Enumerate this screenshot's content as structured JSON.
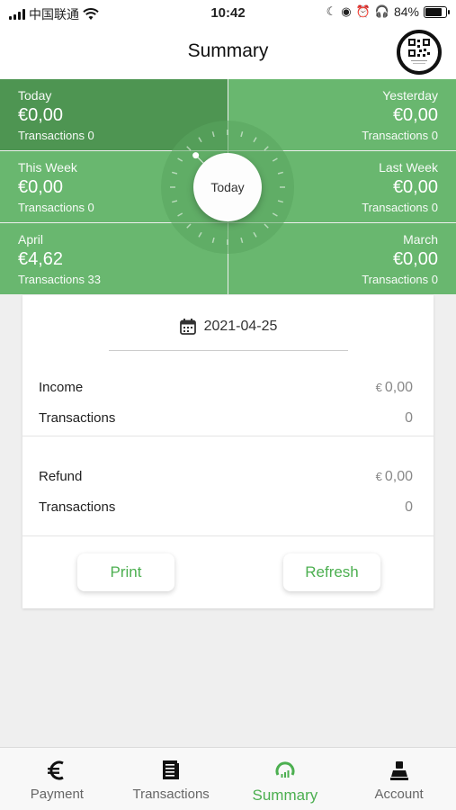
{
  "status_bar": {
    "carrier": "中国联通",
    "time": "10:42",
    "battery": "84%",
    "battery_level": 0.84
  },
  "header": {
    "title": "Summary",
    "avatar_icon": "qr-code-icon"
  },
  "tiles": [
    {
      "label": "Today",
      "amount": "€0,00",
      "transactions": "Transactions 0"
    },
    {
      "label": "Yesterday",
      "amount": "€0,00",
      "transactions": "Transactions 0"
    },
    {
      "label": "This Week",
      "amount": "€0,00",
      "transactions": "Transactions 0"
    },
    {
      "label": "Last Week",
      "amount": "€0,00",
      "transactions": "Transactions 0"
    },
    {
      "label": "April",
      "amount": "€4,62",
      "transactions": "Transactions 33"
    },
    {
      "label": "March",
      "amount": "€0,00",
      "transactions": "Transactions 0"
    }
  ],
  "dial": {
    "label": "Today"
  },
  "card": {
    "date": "2021-04-25",
    "income": {
      "label": "Income",
      "currency": "€",
      "value": "0,00"
    },
    "income_tx": {
      "label": "Transactions",
      "value": "0"
    },
    "refund": {
      "label": "Refund",
      "currency": "€",
      "value": "0,00"
    },
    "refund_tx": {
      "label": "Transactions",
      "value": "0"
    },
    "print_label": "Print",
    "refresh_label": "Refresh"
  },
  "tabbar": {
    "items": [
      {
        "label": "Payment",
        "icon": "euro-icon"
      },
      {
        "label": "Transactions",
        "icon": "receipt-icon"
      },
      {
        "label": "Summary",
        "icon": "summary-icon"
      },
      {
        "label": "Account",
        "icon": "account-icon"
      }
    ]
  },
  "colors": {
    "tile": "#69b76f",
    "tile_active": "#4e9552",
    "accent": "#4caf50"
  }
}
